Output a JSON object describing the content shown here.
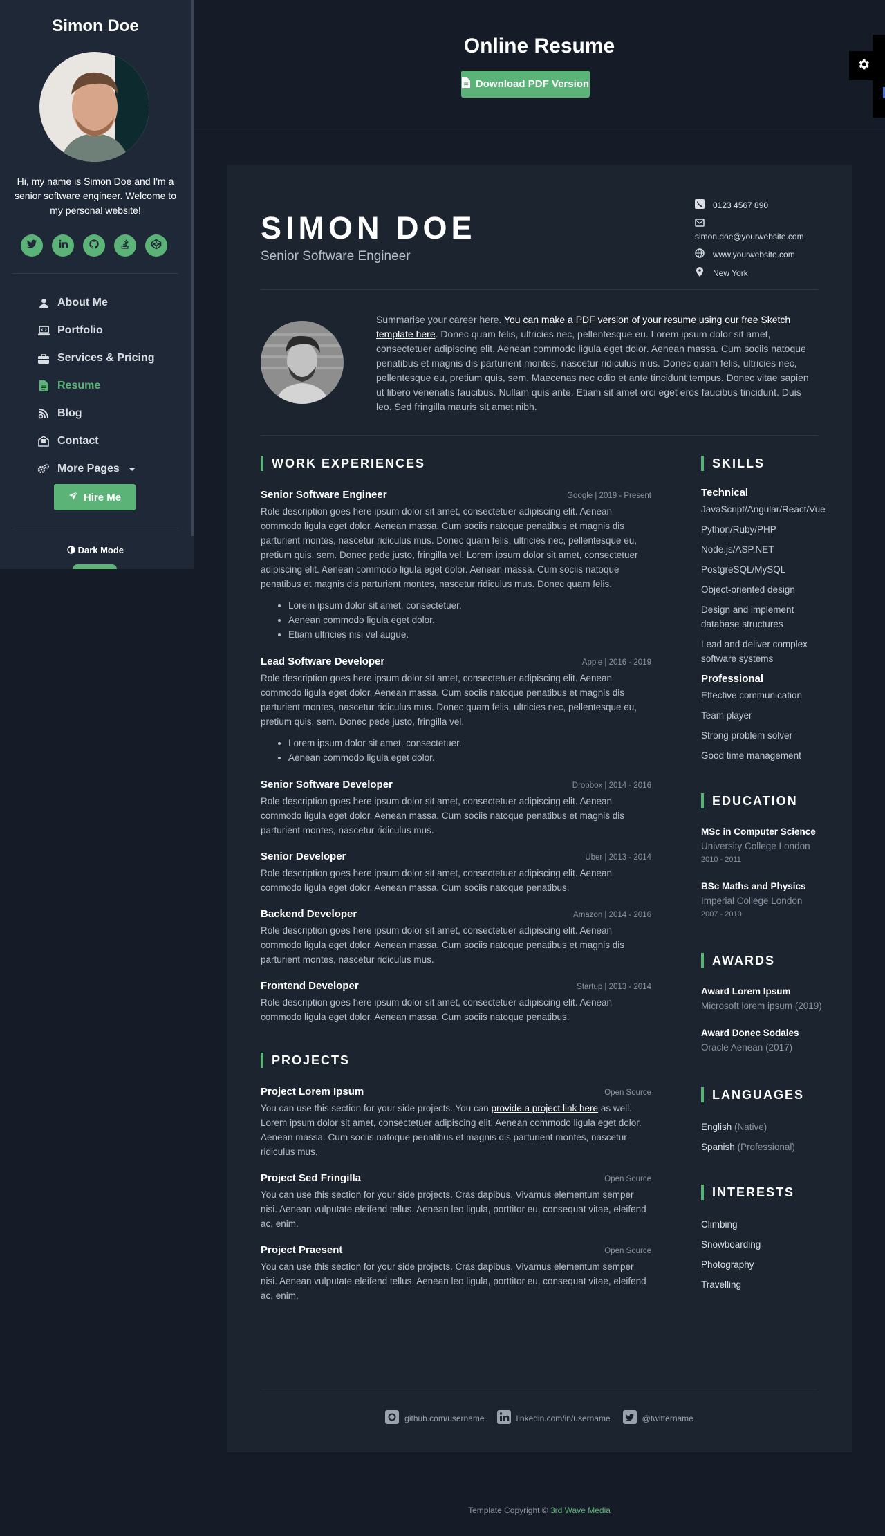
{
  "sidebar": {
    "name": "Simon Doe",
    "bio": "Hi, my name is Simon Doe and I'm a senior software engineer. Welcome to my personal website!",
    "social": [
      "twitter-icon",
      "linkedin-icon",
      "github-icon",
      "stack-overflow-icon",
      "codepen-icon"
    ],
    "nav": [
      {
        "label": "About Me",
        "icon": "user-icon"
      },
      {
        "label": "Portfolio",
        "icon": "laptop-code-icon"
      },
      {
        "label": "Services & Pricing",
        "icon": "briefcase-icon"
      },
      {
        "label": "Resume",
        "icon": "file-icon",
        "active": true
      },
      {
        "label": "Blog",
        "icon": "blog-icon"
      },
      {
        "label": "Contact",
        "icon": "envelope-open-icon"
      },
      {
        "label": "More Pages",
        "icon": "cogs-icon"
      }
    ],
    "hire_label": "Hire Me",
    "dark_mode_label": "Dark Mode"
  },
  "header": {
    "title": "Online Resume",
    "download_label": "Download PDF Version"
  },
  "resume": {
    "name": "SIMON DOE",
    "tagline": "Senior Software Engineer",
    "contact": {
      "phone": "0123 4567 890",
      "email": "simon.doe@yourwebsite.com",
      "website": "www.yourwebsite.com",
      "location": "New York"
    },
    "summary_pre": "Summarise your career here. ",
    "summary_link": "You can make a PDF version of your resume using our free Sketch template here",
    "summary_post": ". Donec quam felis, ultricies nec, pellentesque eu. Lorem ipsum dolor sit amet, consectetuer adipiscing elit. Aenean commodo ligula eget dolor. Aenean massa. Cum sociis natoque penatibus et magnis dis parturient montes, nascetur ridiculus mus. Donec quam felis, ultricies nec, pellentesque eu, pretium quis, sem. Maecenas nec odio et ante tincidunt tempus. Donec vitae sapien ut libero venenatis faucibus. Nullam quis ante. Etiam sit amet orci eget eros faucibus tincidunt. Duis leo. Sed fringilla mauris sit amet nibh.",
    "work_title": "WORK EXPERIENCES",
    "jobs": [
      {
        "title": "Senior Software Engineer",
        "meta": "Google | 2019 - Present",
        "desc": "Role description goes here ipsum dolor sit amet, consectetuer adipiscing elit. Aenean commodo ligula eget dolor. Aenean massa. Cum sociis natoque penatibus et magnis dis parturient montes, nascetur ridiculus mus. Donec quam felis, ultricies nec, pellentesque eu, pretium quis, sem. Donec pede justo, fringilla vel. Lorem ipsum dolor sit amet, consectetuer adipiscing elit. Aenean commodo ligula eget dolor. Aenean massa. Cum sociis natoque penatibus et magnis dis parturient montes, nascetur ridiculus mus. Donec quam felis.",
        "bullets": [
          "Lorem ipsum dolor sit amet, consectetuer.",
          "Aenean commodo ligula eget dolor.",
          "Etiam ultricies nisi vel augue."
        ]
      },
      {
        "title": "Lead Software Developer",
        "meta": "Apple | 2016 - 2019",
        "desc": "Role description goes here ipsum dolor sit amet, consectetuer adipiscing elit. Aenean commodo ligula eget dolor. Aenean massa. Cum sociis natoque penatibus et magnis dis parturient montes, nascetur ridiculus mus. Donec quam felis, ultricies nec, pellentesque eu, pretium quis, sem. Donec pede justo, fringilla vel.",
        "bullets": [
          "Lorem ipsum dolor sit amet, consectetuer.",
          "Aenean commodo ligula eget dolor."
        ]
      },
      {
        "title": "Senior Software Developer",
        "meta": "Dropbox | 2014 - 2016",
        "desc": "Role description goes here ipsum dolor sit amet, consectetuer adipiscing elit. Aenean commodo ligula eget dolor. Aenean massa. Cum sociis natoque penatibus et magnis dis parturient montes, nascetur ridiculus mus."
      },
      {
        "title": "Senior Developer",
        "meta": "Uber | 2013 - 2014",
        "desc": "Role description goes here ipsum dolor sit amet, consectetuer adipiscing elit. Aenean commodo ligula eget dolor. Aenean massa. Cum sociis natoque penatibus."
      },
      {
        "title": "Backend Developer",
        "meta": "Amazon | 2014 - 2016",
        "desc": "Role description goes here ipsum dolor sit amet, consectetuer adipiscing elit. Aenean commodo ligula eget dolor. Aenean massa. Cum sociis natoque penatibus et magnis dis parturient montes, nascetur ridiculus mus."
      },
      {
        "title": "Frontend Developer",
        "meta": "Startup | 2013 - 2014",
        "desc": "Role description goes here ipsum dolor sit amet, consectetuer adipiscing elit. Aenean commodo ligula eget dolor. Aenean massa. Cum sociis natoque penatibus."
      }
    ],
    "projects_title": "PROJECTS",
    "projects": [
      {
        "title": "Project Lorem Ipsum",
        "meta": "Open Source",
        "desc_pre": "You can use this section for your side projects. You can ",
        "desc_link": "provide a project link here",
        "desc_post": " as well. Lorem ipsum dolor sit amet, consectetuer adipiscing elit. Aenean commodo ligula eget dolor. Aenean massa. Cum sociis natoque penatibus et magnis dis parturient montes, nascetur ridiculus mus."
      },
      {
        "title": "Project Sed Fringilla",
        "meta": "Open Source",
        "desc": "You can use this section for your side projects. Cras dapibus. Vivamus elementum semper nisi. Aenean vulputate eleifend tellus. Aenean leo ligula, porttitor eu, consequat vitae, eleifend ac, enim."
      },
      {
        "title": "Project Praesent",
        "meta": "Open Source",
        "desc": "You can use this section for your side projects. Cras dapibus. Vivamus elementum semper nisi. Aenean vulputate eleifend tellus. Aenean leo ligula, porttitor eu, consequat vitae, eleifend ac, enim."
      }
    ],
    "skills_title": "SKILLS",
    "skills_technical_label": "Technical",
    "skills_technical": [
      "JavaScript/Angular/React/Vue",
      "Python/Ruby/PHP",
      "Node.js/ASP.NET",
      "PostgreSQL/MySQL",
      "Object-oriented design",
      "Design and implement database structures",
      "Lead and deliver complex software systems"
    ],
    "skills_professional_label": "Professional",
    "skills_professional": [
      "Effective communication",
      "Team player",
      "Strong problem solver",
      "Good time management"
    ],
    "education_title": "EDUCATION",
    "education": [
      {
        "degree": "MSc in Computer Science",
        "school": "University College London",
        "years": "2010 - 2011"
      },
      {
        "degree": "BSc Maths and Physics",
        "school": "Imperial College London",
        "years": "2007 - 2010"
      }
    ],
    "awards_title": "AWARDS",
    "awards": [
      {
        "name": "Award Lorem Ipsum",
        "detail": "Microsoft lorem ipsum (2019)"
      },
      {
        "name": "Award Donec Sodales",
        "detail": "Oracle Aenean (2017)"
      }
    ],
    "languages_title": "LANGUAGES",
    "languages": [
      {
        "name": "English",
        "level": "(Native)"
      },
      {
        "name": "Spanish",
        "level": "(Professional)"
      }
    ],
    "interests_title": "INTERESTS",
    "interests": [
      "Climbing",
      "Snowboarding",
      "Photography",
      "Travelling"
    ],
    "footer_links": [
      {
        "icon": "github-icon",
        "label": "github.com/username"
      },
      {
        "icon": "linkedin-icon",
        "label": "linkedin.com/in/username"
      },
      {
        "icon": "twitter-icon",
        "label": "@twittername"
      }
    ]
  },
  "footer": {
    "copyright_pre": "Template Copyright © ",
    "brand": "3rd Wave Media"
  },
  "colors": {
    "accent": "#5cb377",
    "background": "#161c27",
    "card": "#1c2430",
    "sidebar": "#1f2836"
  }
}
